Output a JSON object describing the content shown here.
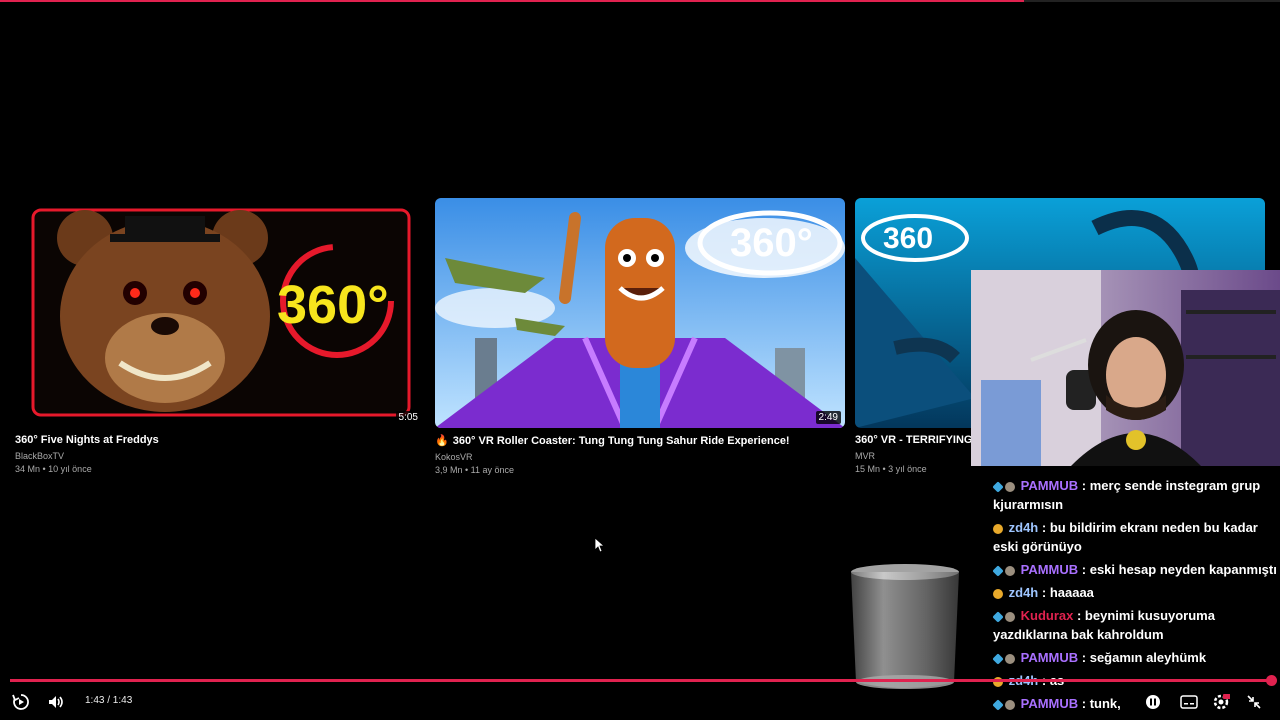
{
  "progress_top": {
    "percent": 80
  },
  "videos": [
    {
      "title": "360° Five Nights at Freddys",
      "channel": "BlackBoxTV",
      "stats": "34 Mn • 10 yıl önce",
      "duration": "5:05",
      "thumb_text": "360°",
      "icon": "freddy-thumbnail"
    },
    {
      "title": "360° VR Roller Coaster: Tung Tung Tung Sahur Ride Experience!",
      "channel": "KokosVR",
      "stats": "3,9 Mn • 11 ay önce",
      "duration": "2:49",
      "thumb_text": "360°",
      "icon": "roller-coaster-thumbnail"
    },
    {
      "title": "360° VR - TERRIFYING S",
      "channel": "MVR",
      "stats": "15 Mn • 3 yıl önce",
      "duration": "",
      "thumb_text": "360",
      "icon": "octopus-thumbnail"
    }
  ],
  "chat": [
    {
      "user": "PAMMUB",
      "color": "#a970ff",
      "badges": [
        "blue",
        "gray"
      ],
      "text": ": merç sende instegram grup kjurarmısın"
    },
    {
      "user": "zd4h",
      "color": "#9ec5ff",
      "badges": [
        "gold"
      ],
      "text": ": bu bildirim ekranı neden bu kadar eski görünüyo"
    },
    {
      "user": "PAMMUB",
      "color": "#a970ff",
      "badges": [
        "blue",
        "gray"
      ],
      "text": ": eski hesap neyden kapanmıştı"
    },
    {
      "user": "zd4h",
      "color": "#9ec5ff",
      "badges": [
        "gold"
      ],
      "text": ": haaaaa"
    },
    {
      "user": "Kudurax",
      "color": "#e0224f",
      "badges": [
        "blue",
        "gray"
      ],
      "text": ": beynimi kusuyoruma yazdıklarına bak kahroldum"
    },
    {
      "user": "PAMMUB",
      "color": "#a970ff",
      "badges": [
        "blue",
        "gray"
      ],
      "text": ": seğamın aleyhümk"
    },
    {
      "user": "zd4h",
      "color": "#9ec5ff",
      "badges": [
        "gold"
      ],
      "text": ": as"
    },
    {
      "user": "PAMMUB",
      "color": "#a970ff",
      "badges": [
        "blue",
        "gray"
      ],
      "text": ": tunk,"
    }
  ],
  "player": {
    "time": "1:43 / 1:43",
    "seek_percent": 100,
    "icons": [
      "replay-icon",
      "volume-icon",
      "pause-icon",
      "subtitles-icon",
      "settings-icon",
      "exit-fullscreen-icon"
    ]
  },
  "colors": {
    "accent": "#e0224f"
  }
}
